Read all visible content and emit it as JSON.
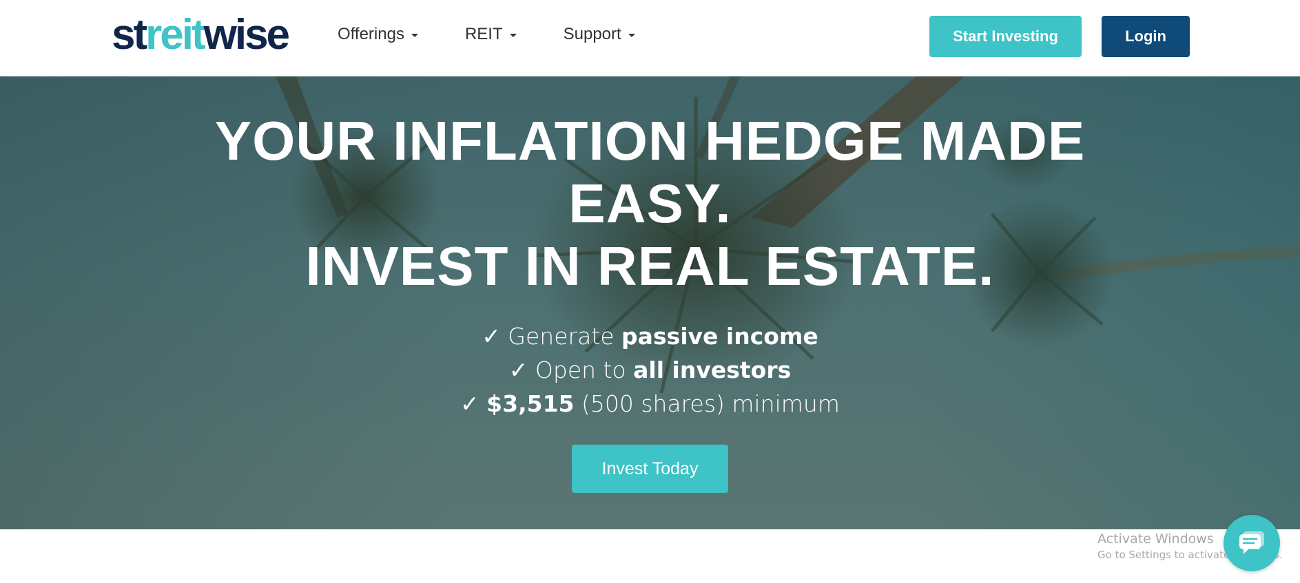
{
  "header": {
    "logo": {
      "part1": "st",
      "part2": "reit",
      "part3": "wise"
    },
    "nav": [
      {
        "label": "Offerings"
      },
      {
        "label": "REIT"
      },
      {
        "label": "Support"
      }
    ],
    "start_investing_label": "Start Investing",
    "login_label": "Login"
  },
  "hero": {
    "headline_line1": "YOUR INFLATION HEDGE MADE EASY.",
    "headline_line2": "INVEST IN REAL ESTATE.",
    "benefits": [
      {
        "check": "✓",
        "pre": "Generate",
        "bold": "passive income",
        "post": ""
      },
      {
        "check": "✓",
        "pre": "Open to",
        "bold": "all investors",
        "post": ""
      },
      {
        "check": "✓",
        "pre": "",
        "bold": "$3,515",
        "post": "(500 shares) minimum"
      }
    ],
    "cta_label": "Invest Today"
  },
  "system_watermark": {
    "title": "Activate Windows",
    "subtitle": "Go to Settings to activate Windows."
  },
  "colors": {
    "brand_navy": "#0f2549",
    "brand_teal": "#3ec3c6",
    "login_blue": "#0f4a78"
  },
  "icons": {
    "chat": "chat-bubble-icon",
    "caret": "caret-down-icon"
  }
}
